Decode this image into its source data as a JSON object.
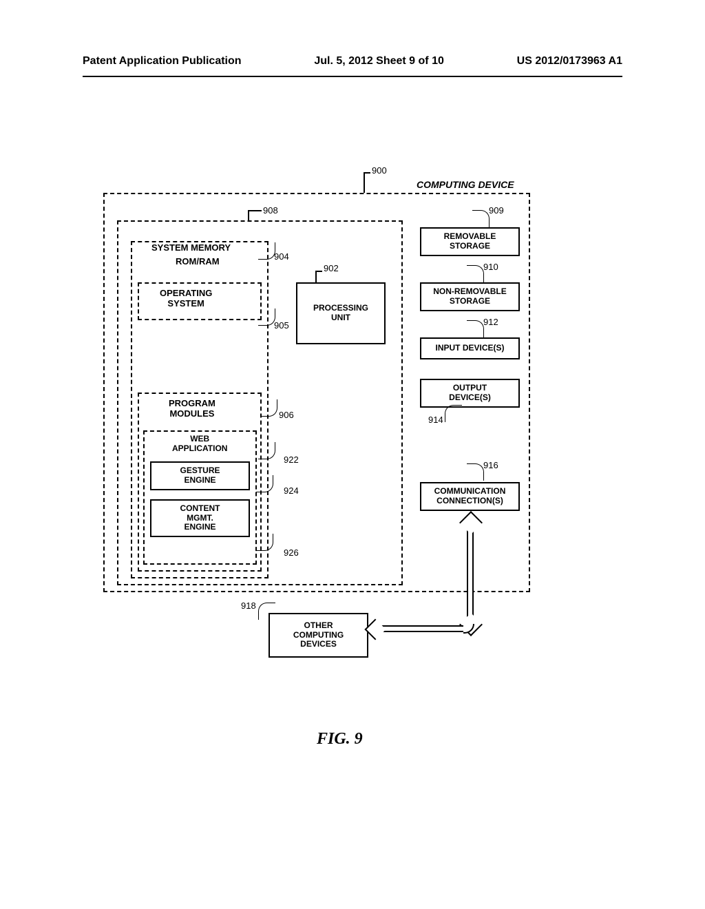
{
  "header": {
    "left": "Patent Application Publication",
    "center": "Jul. 5, 2012   Sheet 9 of 10",
    "right": "US 2012/0173963 A1"
  },
  "figure": "FIG. 9",
  "refs": {
    "r900": "900",
    "r902": "902",
    "r904": "904",
    "r905": "905",
    "r906": "906",
    "r908": "908",
    "r909": "909",
    "r910": "910",
    "r912": "912",
    "r914": "914",
    "r916": "916",
    "r918": "918",
    "r922": "922",
    "r924": "924",
    "r926": "926"
  },
  "blocks": {
    "computing_device": "COMPUTING DEVICE",
    "system_memory": "SYSTEM MEMORY",
    "rom_ram": "ROM/RAM",
    "operating_system": "OPERATING\nSYSTEM",
    "processing_unit": "PROCESSING\nUNIT",
    "program_modules": "PROGRAM\nMODULES",
    "web_application": "WEB\nAPPLICATION",
    "gesture_engine": "GESTURE\nENGINE",
    "content_engine": "CONTENT\nMGMT.\nENGINE",
    "removable_storage": "REMOVABLE\nSTORAGE",
    "nonremovable_storage": "NON-REMOVABLE\nSTORAGE",
    "input_devices": "INPUT DEVICE(S)",
    "output_devices": "OUTPUT\nDEVICE(S)",
    "communication": "COMMUNICATION\nCONNECTION(S)",
    "other_devices": "OTHER\nCOMPUTING\nDEVICES"
  }
}
